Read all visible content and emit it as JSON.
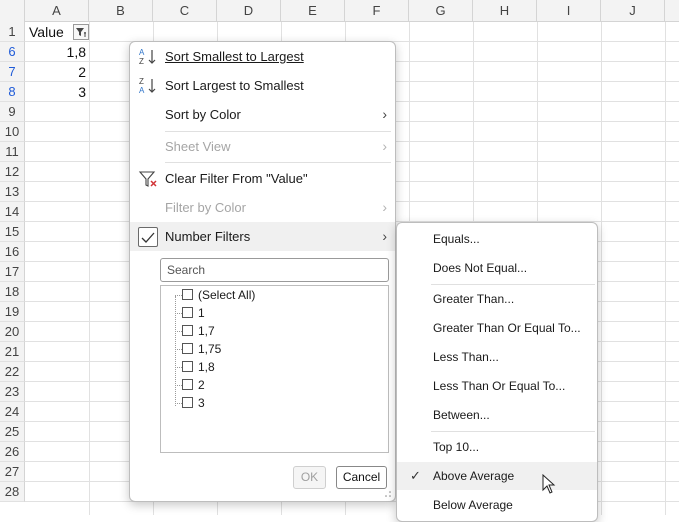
{
  "columns": [
    "A",
    "B",
    "C",
    "D",
    "E",
    "F",
    "G",
    "H",
    "I",
    "J"
  ],
  "rows": [
    "1",
    "6",
    "7",
    "8",
    "9",
    "10",
    "11",
    "12",
    "13",
    "14",
    "15",
    "16",
    "17",
    "18",
    "19",
    "20",
    "21",
    "22",
    "23",
    "24",
    "25",
    "26",
    "27",
    "28"
  ],
  "cells": {
    "header_value": "Value",
    "a6": "1,8",
    "a7": "2",
    "a8": "3"
  },
  "menu": {
    "sort_asc": "Sort Smallest to Largest",
    "sort_desc": "Sort Largest to Smallest",
    "sort_color": "Sort by Color",
    "sheet_view": "Sheet View",
    "clear_filter": "Clear Filter From \"Value\"",
    "filter_color": "Filter by Color",
    "number_filters": "Number Filters",
    "search_placeholder": "Search",
    "list": [
      "(Select All)",
      "1",
      "1,7",
      "1,75",
      "1,8",
      "2",
      "3"
    ],
    "ok": "OK",
    "cancel": "Cancel"
  },
  "submenu": {
    "equals": "Equals...",
    "not_equal": "Does Not Equal...",
    "greater": "Greater Than...",
    "greater_equal": "Greater Than Or Equal To...",
    "less": "Less Than...",
    "less_equal": "Less Than Or Equal To...",
    "between": "Between...",
    "top10": "Top 10...",
    "above_avg": "Above Average",
    "below_avg": "Below Average"
  },
  "colors": {
    "filtered_row_number": "#1f5bd8",
    "sort_icon_blue": "#2e74c9",
    "clear_filter_red": "#d13438"
  }
}
